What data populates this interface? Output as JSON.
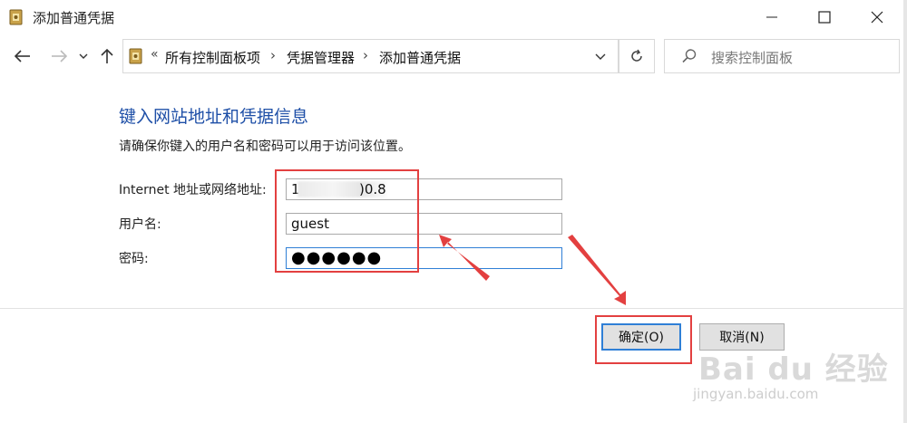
{
  "window": {
    "title": "添加普通凭据"
  },
  "addressbar": {
    "overflow_marker": "«",
    "crumbs": [
      "所有控制面板项",
      "凭据管理器",
      "添加普通凭据"
    ],
    "separator": "›"
  },
  "search": {
    "placeholder": "搜索控制面板"
  },
  "content": {
    "heading": "键入网站地址和凭据信息",
    "description": "请确保你键入的用户名和密码可以用于访问该位置。",
    "fields": {
      "address": {
        "label": "Internet 地址或网络地址:",
        "value_prefix": "1(",
        "value_suffix": ")0.8"
      },
      "username": {
        "label": "用户名:",
        "value": "guest"
      },
      "password": {
        "label": "密码:",
        "value": "●●●●●●"
      }
    }
  },
  "buttons": {
    "ok": "确定(O)",
    "cancel": "取消(N)"
  },
  "watermark": {
    "logo": "Bai du 经验",
    "url": "jingyan.baidu.com"
  },
  "colors": {
    "heading": "#1e4fa7",
    "annotation": "#e34040",
    "focus": "#2f7fd6"
  },
  "icons": {
    "app": "credential-manager-icon",
    "back": "back-arrow-icon",
    "forward": "forward-arrow-icon",
    "recent": "chevron-down-icon",
    "up": "up-arrow-icon",
    "refresh": "refresh-icon",
    "search": "search-icon"
  }
}
